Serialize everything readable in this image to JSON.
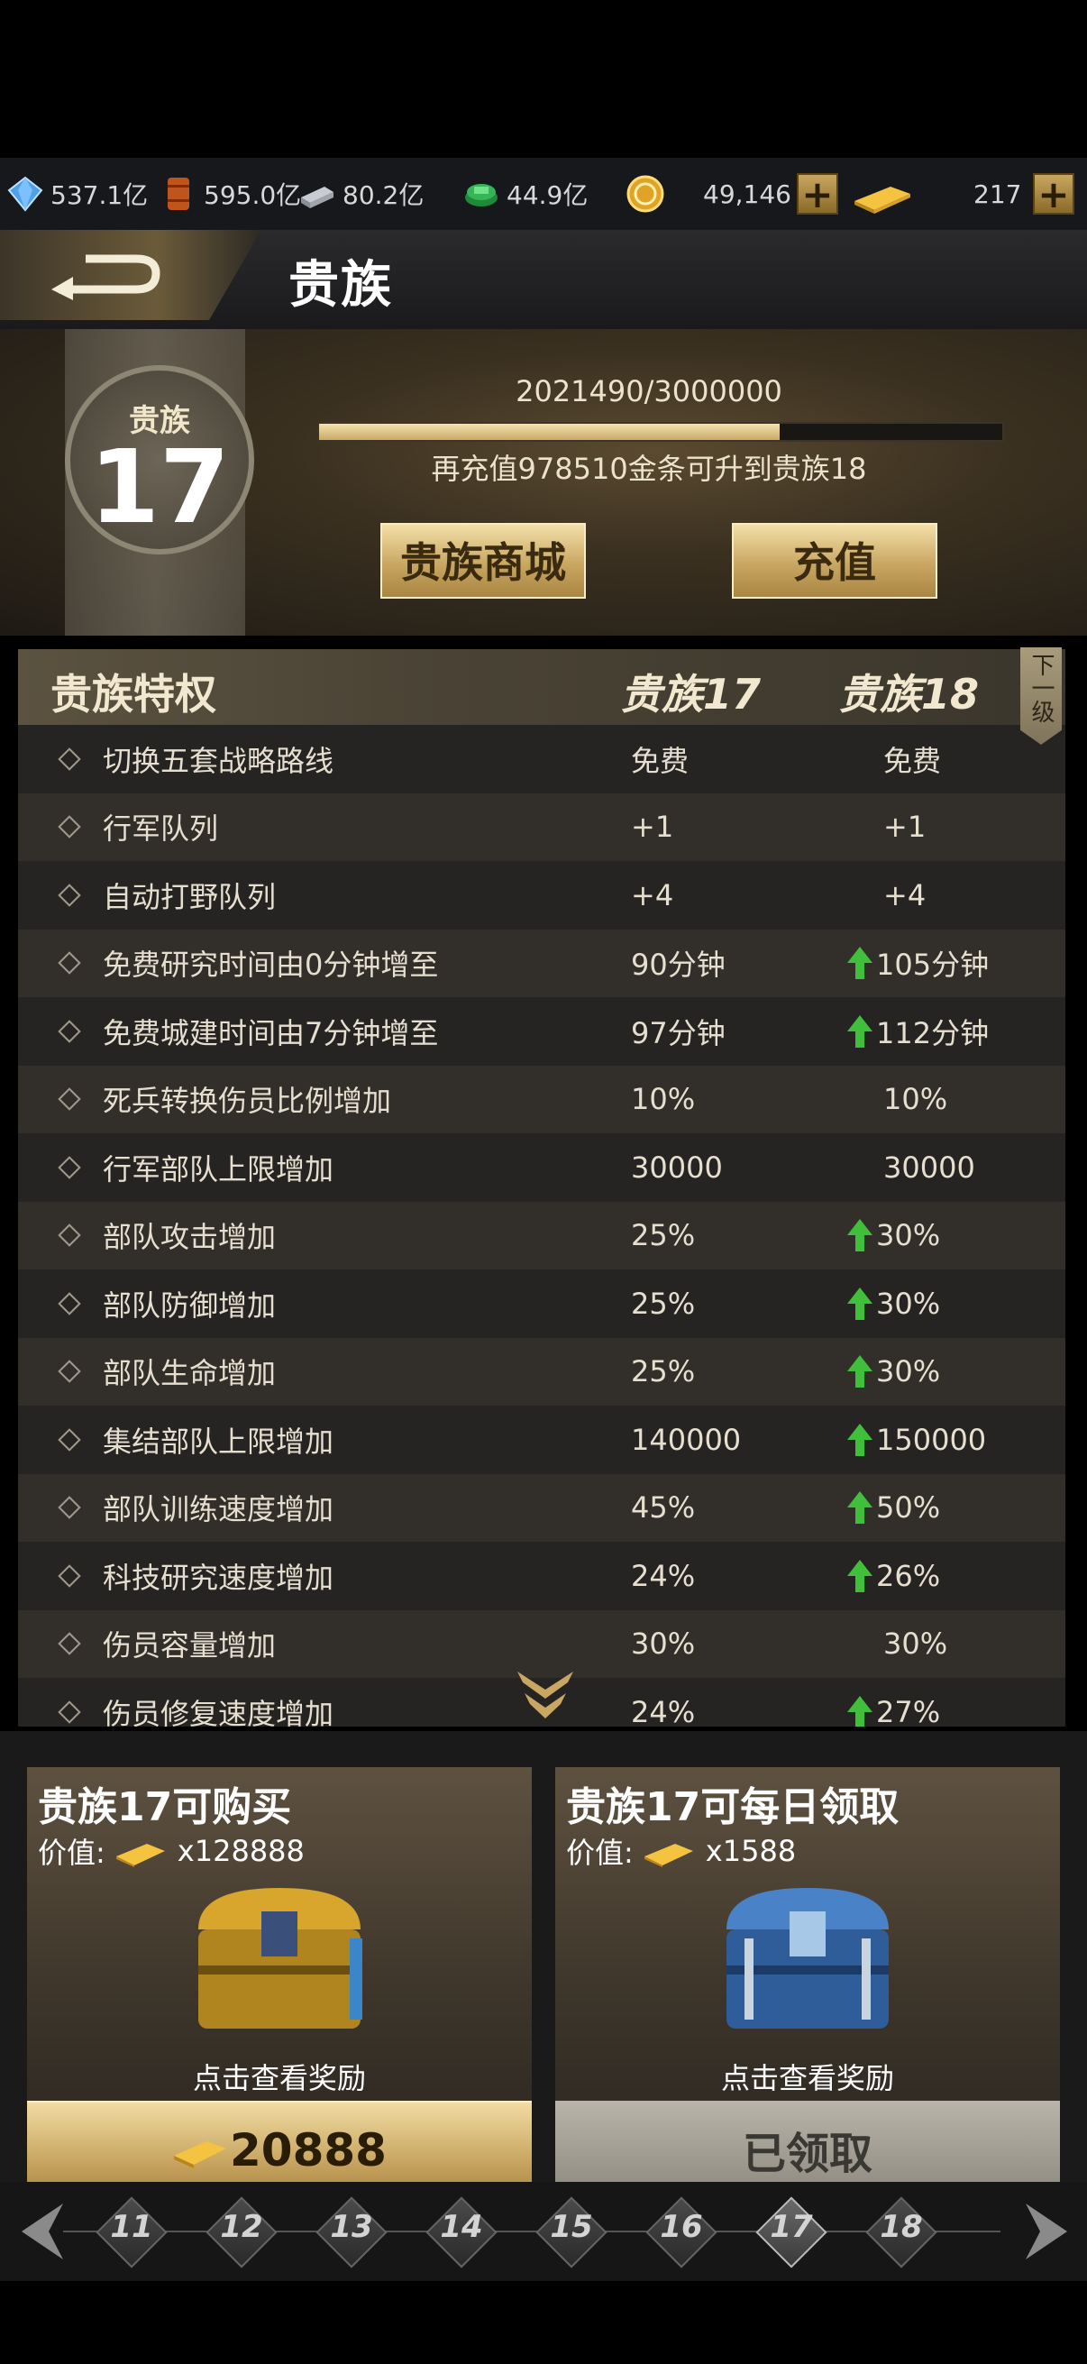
{
  "resources": [
    {
      "icon": "crystal-icon",
      "value": "537.1亿"
    },
    {
      "icon": "oil-barrel-icon",
      "value": "595.0亿"
    },
    {
      "icon": "steel-icon",
      "value": "80.2亿"
    },
    {
      "icon": "cash-icon",
      "value": "44.9亿"
    },
    {
      "icon": "gold-coin-icon",
      "value": "49,146"
    },
    {
      "icon": "gold-bar-icon",
      "value": "217"
    }
  ],
  "header": {
    "title": "贵族"
  },
  "noble": {
    "badge_label": "贵族",
    "level": "17",
    "progress_text": "2021490/3000000",
    "progress_fraction": 0.674,
    "upgrade_hint": "再充值978510金条可升到贵族18",
    "shop_button": "贵族商城",
    "recharge_button": "充值"
  },
  "table": {
    "col_privilege": "贵族特权",
    "col_current": "贵族17",
    "col_next": "贵族18",
    "next_level_tab": "下一级",
    "rows": [
      {
        "name": "切换五套战略路线",
        "v17": "免费",
        "v18": "免费",
        "up": false
      },
      {
        "name": "行军队列",
        "v17": "+1",
        "v18": "+1",
        "up": false
      },
      {
        "name": "自动打野队列",
        "v17": "+4",
        "v18": "+4",
        "up": false
      },
      {
        "name": "免费研究时间由0分钟增至",
        "v17": "90分钟",
        "v18": "105分钟",
        "up": true
      },
      {
        "name": "免费城建时间由7分钟增至",
        "v17": "97分钟",
        "v18": "112分钟",
        "up": true
      },
      {
        "name": "死兵转换伤员比例增加",
        "v17": "10%",
        "v18": "10%",
        "up": false
      },
      {
        "name": "行军部队上限增加",
        "v17": "30000",
        "v18": "30000",
        "up": false
      },
      {
        "name": "部队攻击增加",
        "v17": "25%",
        "v18": "30%",
        "up": true
      },
      {
        "name": "部队防御增加",
        "v17": "25%",
        "v18": "30%",
        "up": true
      },
      {
        "name": "部队生命增加",
        "v17": "25%",
        "v18": "30%",
        "up": true
      },
      {
        "name": "集结部队上限增加",
        "v17": "140000",
        "v18": "150000",
        "up": true
      },
      {
        "name": "部队训练速度增加",
        "v17": "45%",
        "v18": "50%",
        "up": true
      },
      {
        "name": "科技研究速度增加",
        "v17": "24%",
        "v18": "26%",
        "up": true
      },
      {
        "name": "伤员容量增加",
        "v17": "30%",
        "v18": "30%",
        "up": false
      },
      {
        "name": "伤员修复速度增加",
        "v17": "24%",
        "v18": "27%",
        "up": true
      }
    ]
  },
  "cards": {
    "buy": {
      "title": "贵族17可购买",
      "value_label": "价值:",
      "value": "x128888",
      "caption": "点击查看奖励",
      "price": "20888"
    },
    "daily": {
      "title": "贵族17可每日领取",
      "value_label": "价值:",
      "value": "x1588",
      "caption": "点击查看奖励",
      "status": "已领取"
    }
  },
  "levels": [
    "11",
    "12",
    "13",
    "14",
    "15",
    "16",
    "17",
    "18"
  ],
  "active_level": "17"
}
